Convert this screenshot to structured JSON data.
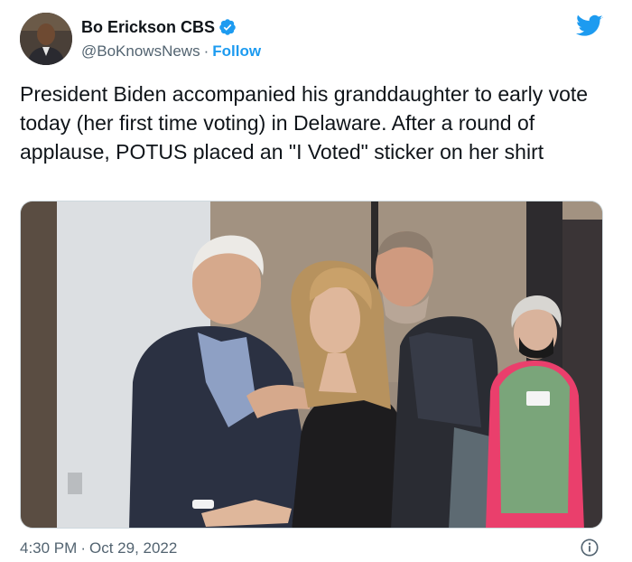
{
  "author": {
    "display_name": "Bo Erickson CBS",
    "handle": "@BoKnowsNews",
    "separator": "·",
    "follow_label": "Follow"
  },
  "icons": {
    "verified": "verified-badge-icon",
    "logo": "twitter-bird-icon",
    "info": "info-icon"
  },
  "colors": {
    "accent": "#1d9bf0",
    "secondary_text": "#536471",
    "primary_text": "#0f1419"
  },
  "tweet": {
    "text": "President Biden accompanied his granddaughter to early vote today (her first time voting) in Delaware. After a round of applause, POTUS placed an \"I Voted\" sticker on her shirt"
  },
  "meta": {
    "time": "4:30 PM",
    "separator": "·",
    "date": "Oct 29, 2022"
  }
}
